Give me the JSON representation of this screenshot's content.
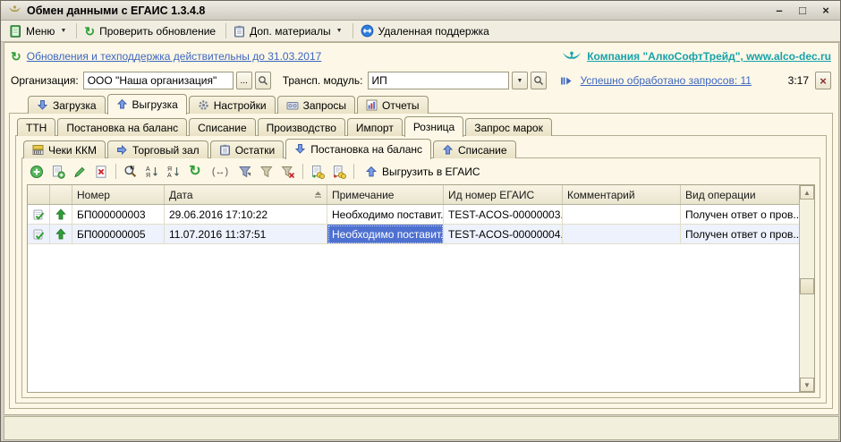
{
  "titlebar": {
    "title": "Обмен данными с ЕГАИС 1.3.4.8"
  },
  "icons": {
    "minimize": "–",
    "maximize": "□",
    "close": "×",
    "caret": "▼",
    "refresh": "↻",
    "fit_width": "(↔)",
    "scroll_up": "▲",
    "scroll_down": "▼"
  },
  "menubar": {
    "menu": "Меню",
    "check_update": "Проверить обновление",
    "materials": "Доп. материалы",
    "remote_support": "Удаленная поддержка"
  },
  "infobar": {
    "update_link": "Обновления и техподдержка действительны до 31.03.2017",
    "company_link": "Компания \"АлкоСофтТрейд\", www.alco-dec.ru"
  },
  "orgbar": {
    "org_label": "Организация:",
    "org_value": "ООО \"Наша организация\"",
    "browse": "...",
    "transport_label": "Трансп. модуль:",
    "transport_value": "ИП",
    "processed_link": "Успешно обработано запросов: 11",
    "timer": "3:17",
    "close": "×"
  },
  "tabs_level1": {
    "items": [
      "Загрузка",
      "Выгрузка",
      "Настройки",
      "Запросы",
      "Отчеты"
    ],
    "active": "Выгрузка"
  },
  "tabs_level2": {
    "items": [
      "ТТН",
      "Постановка на баланс",
      "Списание",
      "Производство",
      "Импорт",
      "Розница",
      "Запрос марок"
    ],
    "active": "Розница"
  },
  "tabs_level3": {
    "items": [
      "Чеки ККМ",
      "Торговый зал",
      "Остатки",
      "Постановка на баланс",
      "Списание"
    ],
    "active": "Постановка на баланс"
  },
  "toolbar": {
    "upload_label": "Выгрузить в ЕГАИС"
  },
  "table": {
    "columns": [
      "Номер",
      "Дата",
      "Примечание",
      "Ид номер ЕГАИС",
      "Комментарий",
      "Вид операции"
    ],
    "rows": [
      {
        "number": "БП000000003",
        "date": "29.06.2016 17:10:22",
        "note": "Необходимо поставит...",
        "egais_id": "TEST-ACOS-00000003...",
        "comment": "",
        "operation": "Получен ответ о пров..."
      },
      {
        "number": "БП000000005",
        "date": "11.07.2016 11:37:51",
        "note": "Необходимо поставит...",
        "egais_id": "TEST-ACOS-00000004...",
        "comment": "",
        "operation": "Получен ответ о пров..."
      }
    ]
  },
  "colors": {
    "selection": "#4e70d0",
    "link_blue": "#3e67c0",
    "link_teal": "#18a2aa",
    "cream_bg": "#fcf7e6",
    "icon_green": "#2f9e38"
  }
}
